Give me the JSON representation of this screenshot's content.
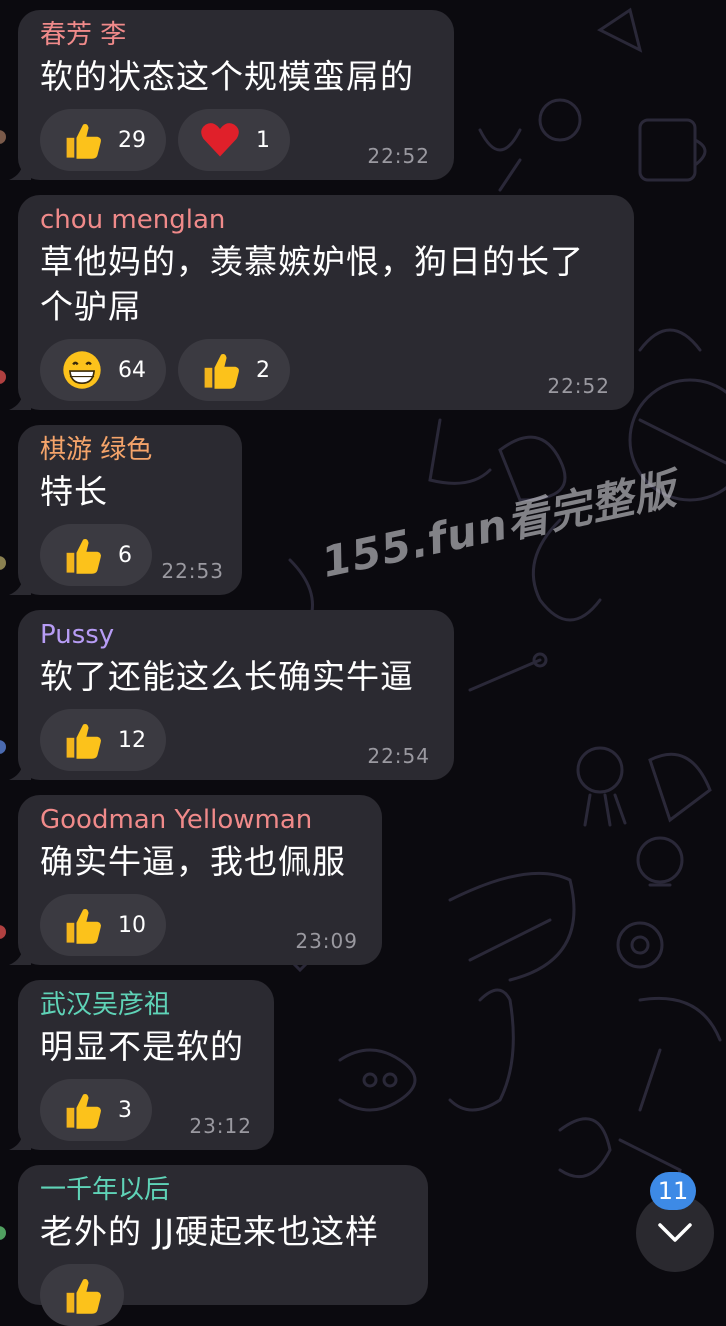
{
  "colors": {
    "background": "#0b0a0f",
    "bubble": "#2b2a31",
    "reaction_pill": "#3b3a41",
    "time": "#9a99a0",
    "badge": "#3d8ae6"
  },
  "watermark": "155.fun看完整版",
  "messages": [
    {
      "sender": "春芳 李",
      "sender_color": "#f08a8a",
      "text": "软的状态这个规模蛮屌的",
      "reactions": [
        {
          "icon": "thumbs-up-icon",
          "count": "29"
        },
        {
          "icon": "red-heart-icon",
          "count": "1"
        }
      ],
      "time": "22:52"
    },
    {
      "sender": "chou menglan",
      "sender_color": "#f08a8a",
      "text": "草他妈的，羡慕嫉妒恨，狗日的长了个驴屌",
      "reactions": [
        {
          "icon": "grinning-face-icon",
          "count": "64"
        },
        {
          "icon": "thumbs-up-icon",
          "count": "2"
        }
      ],
      "time": "22:52"
    },
    {
      "sender": "棋游 绿色",
      "sender_color": "#f5a46a",
      "text": "特长",
      "reactions": [
        {
          "icon": "thumbs-up-icon",
          "count": "6"
        }
      ],
      "time": "22:53"
    },
    {
      "sender": "Pussy",
      "sender_color": "#b79cf5",
      "text": "软了还能这么长确实牛逼",
      "reactions": [
        {
          "icon": "thumbs-up-icon",
          "count": "12"
        }
      ],
      "time": "22:54"
    },
    {
      "sender": "Goodman Yellowman",
      "sender_color": "#f08a8a",
      "text": "确实牛逼，我也佩服",
      "reactions": [
        {
          "icon": "thumbs-up-icon",
          "count": "10"
        }
      ],
      "time": "23:09"
    },
    {
      "sender": "武汉吴彦祖",
      "sender_color": "#5fd3b7",
      "text": "明显不是软的",
      "reactions": [
        {
          "icon": "thumbs-up-icon",
          "count": "3"
        }
      ],
      "time": "23:12"
    },
    {
      "sender": "一千年以后",
      "sender_color": "#5fd3b7",
      "text": "老外的 JJ硬起来也这样",
      "reactions": [],
      "time": ""
    }
  ],
  "scroll_down": {
    "icon": "chevron-down-icon",
    "unread_count": "11"
  }
}
